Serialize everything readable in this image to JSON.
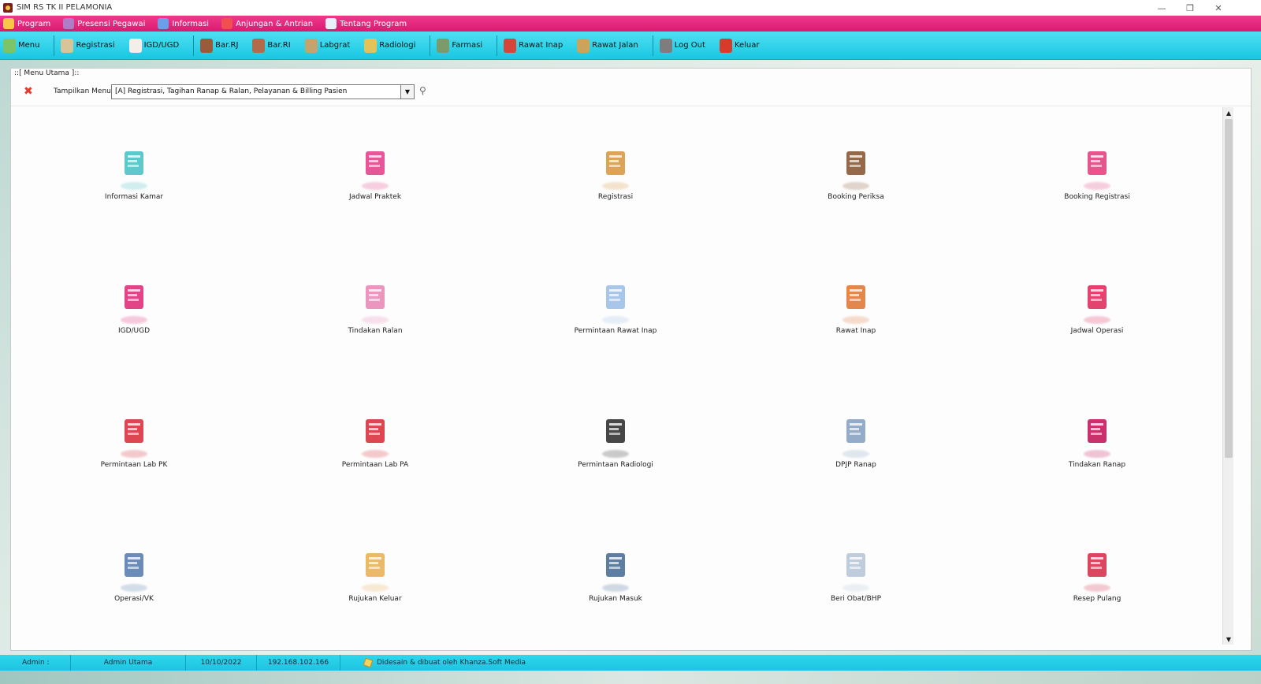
{
  "window": {
    "title": "SIM RS TK II PELAMONIA",
    "controls": [
      "—",
      "❐",
      "✕"
    ]
  },
  "menubar": {
    "items": [
      {
        "label": "Program",
        "icon": "key-icon",
        "color": "#f7c64a"
      },
      {
        "label": "Presensi Pegawai",
        "icon": "person-icon",
        "color": "#b07cc6"
      },
      {
        "label": "Informasi",
        "icon": "books-icon",
        "color": "#6d9ee8"
      },
      {
        "label": "Anjungan & Antrian",
        "icon": "lifebuoy-icon",
        "color": "#f25050"
      },
      {
        "label": "Tentang Program",
        "icon": "document-icon",
        "color": "#e9f0f7"
      }
    ]
  },
  "toolbar": {
    "items": [
      {
        "label": "Menu",
        "icon": "home-icon",
        "color": "#7cc36a"
      },
      {
        "label": "Registrasi",
        "icon": "registration-card-icon",
        "color": "#d8c49a"
      },
      {
        "label": "IGD/UGD",
        "icon": "patient-icon",
        "color": "#f2efe9"
      },
      {
        "label": "Bar.RJ",
        "icon": "book-icon",
        "color": "#9c5a3c"
      },
      {
        "label": "Bar.RI",
        "icon": "books-stack-icon",
        "color": "#b16b4a"
      },
      {
        "label": "Labgrat",
        "icon": "lab-icon",
        "color": "#c3a36e"
      },
      {
        "label": "Radiologi",
        "icon": "radiology-icon",
        "color": "#e2c35b"
      },
      {
        "label": "Farmasi",
        "icon": "pharmacy-cart-icon",
        "color": "#7b9c6a"
      },
      {
        "label": "Rawat Inap",
        "icon": "house-red-icon",
        "color": "#d7453a"
      },
      {
        "label": "Rawat Jalan",
        "icon": "outpatient-icon",
        "color": "#c9a45a"
      },
      {
        "label": "Log Out",
        "icon": "logout-key-icon",
        "color": "#7d7d7d"
      },
      {
        "label": "Keluar",
        "icon": "exit-x-icon",
        "color": "#d83a2c"
      }
    ]
  },
  "panel": {
    "caption": "::[ Menu Utama ]::",
    "filter_label": "Tampilkan Menu :",
    "filter_value": "[A] Registrasi, Tagihan Ranap & Ralan, Pelayanan & Billing Pasien",
    "dropdown_arrow": "▼",
    "search_glyph": "⚲",
    "close_glyph": "✖"
  },
  "tiles": [
    {
      "label": "Informasi Kamar",
      "icon": "room-door-icon",
      "color": "#4fc1c6"
    },
    {
      "label": "Jadwal Praktek",
      "icon": "doctors-group-icon",
      "color": "#e2458c"
    },
    {
      "label": "Registrasi",
      "icon": "clipboard-icon",
      "color": "#d79a46"
    },
    {
      "label": "Booking Periksa",
      "icon": "address-book-icon",
      "color": "#8a5a36"
    },
    {
      "label": "Booking Registrasi",
      "icon": "devices-icon",
      "color": "#e0457f"
    },
    {
      "label": "IGD/UGD",
      "icon": "igd-sign-icon",
      "color": "#e0307a"
    },
    {
      "label": "Tindakan Ralan",
      "icon": "infusion-icon",
      "color": "#e88bb8"
    },
    {
      "label": "Permintaan Rawat Inap",
      "icon": "request-paper-icon",
      "color": "#9fc0e8"
    },
    {
      "label": "Rawat Inap",
      "icon": "hospital-building-icon",
      "color": "#e07b3a"
    },
    {
      "label": "Jadwal Operasi",
      "icon": "surgeon-icon",
      "color": "#e0305f"
    },
    {
      "label": "Permintaan Lab PK",
      "icon": "flask-icon",
      "color": "#d8333f"
    },
    {
      "label": "Permintaan Lab PA",
      "icon": "flask-icon",
      "color": "#d8333f"
    },
    {
      "label": "Permintaan Radiologi",
      "icon": "xray-film-icon",
      "color": "#333333"
    },
    {
      "label": "DPJP Ranap",
      "icon": "doctor-icon",
      "color": "#8aa3c2"
    },
    {
      "label": "Tindakan Ranap",
      "icon": "hospital-bed-icon",
      "color": "#c41b5c"
    },
    {
      "label": "Operasi/VK",
      "icon": "surgeon-masked-icon",
      "color": "#5b7fae"
    },
    {
      "label": "Rujukan Keluar",
      "icon": "nurse-icon",
      "color": "#e8b25a"
    },
    {
      "label": "Rujukan Masuk",
      "icon": "document-list-icon",
      "color": "#4b6f97"
    },
    {
      "label": "Beri Obat/BHP",
      "icon": "first-aid-kit-icon",
      "color": "#b7c6d8"
    },
    {
      "label": "Resep Pulang",
      "icon": "prescription-icon",
      "color": "#d8334f"
    }
  ],
  "statusbar": {
    "user_label": "Admin :",
    "user_name": "Admin Utama",
    "date": "10/10/2022",
    "ip": "192.168.102.166",
    "credit": "Didesain & dibuat oleh Khanza.Soft Media"
  },
  "scrollbar": {
    "up": "▲",
    "down": "▼"
  }
}
